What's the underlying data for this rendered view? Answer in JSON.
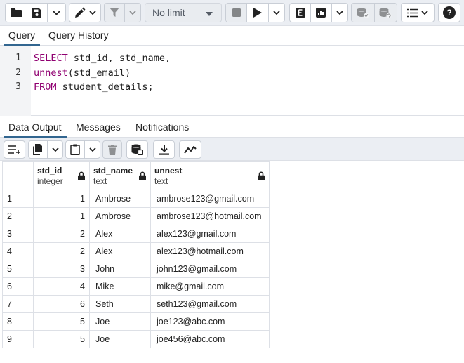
{
  "toolbar": {
    "limit_select": {
      "value": "No limit"
    },
    "icons": [
      "folder-icon",
      "save-icon",
      "chevron-down-icon",
      "pen-icon",
      "filter-icon",
      "stop-icon",
      "play-icon",
      "explain-icon",
      "explain-analyze-icon",
      "commit-icon",
      "rollback-icon",
      "macros-icon",
      "help-icon"
    ],
    "help_label": "?"
  },
  "query_tabs": [
    {
      "label": "Query",
      "active": true
    },
    {
      "label": "Query History",
      "active": false
    }
  ],
  "editor": {
    "lines": [
      {
        "num": "1",
        "tokens": [
          {
            "t": "SELECT",
            "k": "kw"
          },
          {
            "t": " std_id, std_name,",
            "k": "plain"
          }
        ]
      },
      {
        "num": "2",
        "tokens": [
          {
            "t": "unnest",
            "k": "fn"
          },
          {
            "t": "(std_email)",
            "k": "plain"
          }
        ]
      },
      {
        "num": "3",
        "tokens": [
          {
            "t": "FROM",
            "k": "kw"
          },
          {
            "t": " student_details;",
            "k": "plain"
          }
        ]
      }
    ]
  },
  "output_tabs": [
    {
      "label": "Data Output",
      "active": true
    },
    {
      "label": "Messages",
      "active": false
    },
    {
      "label": "Notifications",
      "active": false
    }
  ],
  "grid": {
    "columns": [
      {
        "name": "std_id",
        "type": "integer",
        "align": "right"
      },
      {
        "name": "std_name",
        "type": "text",
        "align": "left"
      },
      {
        "name": "unnest",
        "type": "text",
        "align": "left"
      }
    ],
    "rows": [
      [
        "1",
        "1",
        "Ambrose",
        "ambrose123@gmail.com"
      ],
      [
        "2",
        "1",
        "Ambrose",
        "ambrose123@hotmail.com"
      ],
      [
        "3",
        "2",
        "Alex",
        "alex123@gmail.com"
      ],
      [
        "4",
        "2",
        "Alex",
        "alex123@hotmail.com"
      ],
      [
        "5",
        "3",
        "John",
        "john123@gmail.com"
      ],
      [
        "6",
        "4",
        "Mike",
        "mike@gmail.com"
      ],
      [
        "7",
        "6",
        "Seth",
        "seth123@gmail.com"
      ],
      [
        "8",
        "5",
        "Joe",
        "joe123@abc.com"
      ],
      [
        "9",
        "5",
        "Joe",
        "joe456@abc.com"
      ]
    ]
  },
  "colors": {
    "keyword": "#900071",
    "active_tab_underline": "#326690",
    "toolbar_bg": "#ebeef3"
  }
}
